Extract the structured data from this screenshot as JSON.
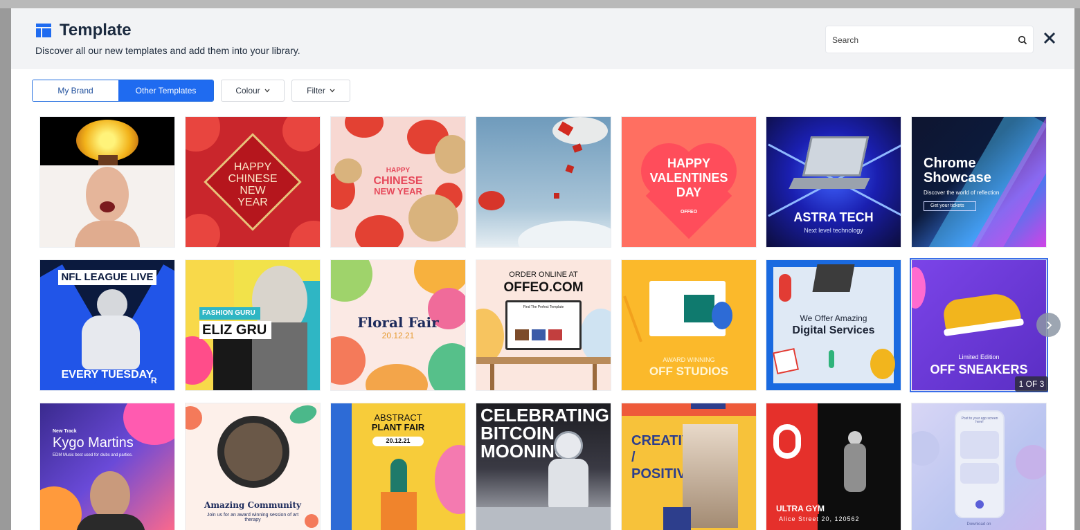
{
  "header": {
    "title": "Template",
    "subtitle": "Discover all our new templates and add them into your library.",
    "search_placeholder": "Search"
  },
  "toolbar": {
    "my_brand": "My Brand",
    "other_templates": "Other Templates",
    "colour": "Colour",
    "filter": "Filter"
  },
  "carousel": {
    "page_indicator": "1 OF 3"
  },
  "colors": {
    "accent": "#1f6bf0",
    "title": "#1b2a3f"
  },
  "tiles": [
    {
      "row": 1,
      "col": 1,
      "text": []
    },
    {
      "row": 1,
      "col": 2,
      "text": [
        "HAPPY",
        "CHINESE",
        "NEW",
        "YEAR"
      ]
    },
    {
      "row": 1,
      "col": 3,
      "text": [
        "HAPPY",
        "CHINESE",
        "NEW YEAR"
      ]
    },
    {
      "row": 1,
      "col": 4,
      "text": []
    },
    {
      "row": 1,
      "col": 5,
      "text": [
        "HAPPY",
        "VALENTINES",
        "DAY",
        "OFFEO"
      ]
    },
    {
      "row": 1,
      "col": 6,
      "text": [
        "ASTRA TECH",
        "Next level technology"
      ]
    },
    {
      "row": 1,
      "col": 7,
      "text": [
        "Chrome",
        "Showcase",
        "Discover the world of reflection",
        "Get your tickets"
      ]
    },
    {
      "row": 2,
      "col": 1,
      "text": [
        "NFL LEAGUE LIVE",
        "EVERY TUESDAY",
        "R"
      ]
    },
    {
      "row": 2,
      "col": 2,
      "text": [
        "FASHION GURU",
        "ELIZ GRU"
      ]
    },
    {
      "row": 2,
      "col": 3,
      "text": [
        "Floral Fair",
        "20.12.21"
      ]
    },
    {
      "row": 2,
      "col": 4,
      "text": [
        "ORDER ONLINE AT",
        "OFFEO.COM",
        "Find The Perfect Template"
      ]
    },
    {
      "row": 2,
      "col": 5,
      "text": [
        "AWARD WINNING",
        "OFF STUDIOS"
      ]
    },
    {
      "row": 2,
      "col": 6,
      "text": [
        "We Offer Amazing",
        "Digital Services"
      ]
    },
    {
      "row": 2,
      "col": 7,
      "text": [
        "Limited Edition",
        "OFF SNEAKERS"
      ]
    },
    {
      "row": 3,
      "col": 1,
      "text": [
        "New Track",
        "Kygo Martins",
        "EDM Music best used for clubs and parties."
      ]
    },
    {
      "row": 3,
      "col": 2,
      "text": [
        "Amazing Community",
        "Join us for an award winning session of art therapy"
      ]
    },
    {
      "row": 3,
      "col": 3,
      "text": [
        "ABSTRACT",
        "PLANT FAIR",
        "20.12.21"
      ]
    },
    {
      "row": 3,
      "col": 4,
      "text": [
        "CELEBRATING",
        "BITCOIN",
        "MOONING"
      ]
    },
    {
      "row": 3,
      "col": 5,
      "text": [
        "CREATIVE",
        "/",
        "POSITIVE"
      ]
    },
    {
      "row": 3,
      "col": 6,
      "text": [
        "ULTRA GYM",
        "Alice Street 20, 120562"
      ]
    },
    {
      "row": 3,
      "col": 7,
      "text": [
        "Post to your app screen here!",
        "Download on"
      ]
    }
  ]
}
